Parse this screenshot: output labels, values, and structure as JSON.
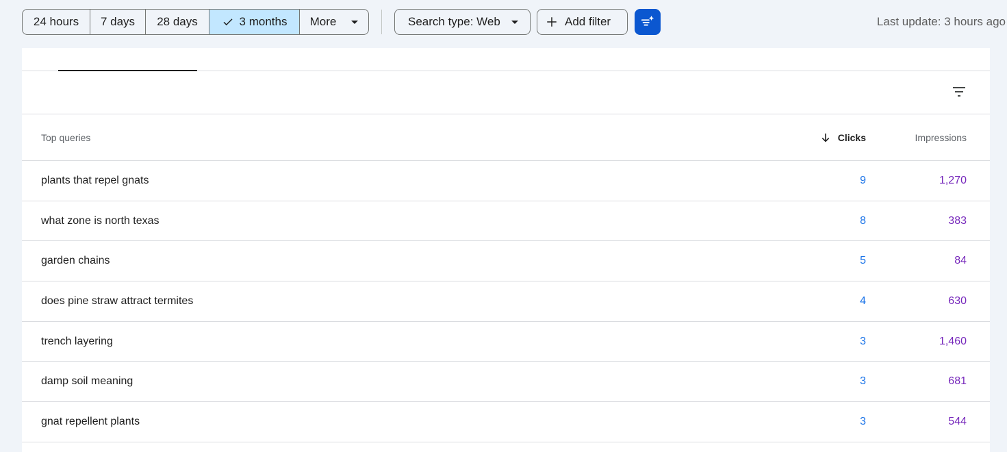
{
  "toolbar": {
    "date_ranges": [
      {
        "label": "24 hours",
        "active": false
      },
      {
        "label": "7 days",
        "active": false
      },
      {
        "label": "28 days",
        "active": false
      },
      {
        "label": "3 months",
        "active": true
      }
    ],
    "more_label": "More",
    "search_type_label": "Search type: Web",
    "add_filter_label": "Add filter",
    "last_update": "Last update: 3 hours ago"
  },
  "table": {
    "headers": {
      "query": "Top queries",
      "clicks": "Clicks",
      "impressions": "Impressions"
    },
    "rows": [
      {
        "query": "plants that repel gnats",
        "clicks": "9",
        "impressions": "1,270"
      },
      {
        "query": "what zone is north texas",
        "clicks": "8",
        "impressions": "383"
      },
      {
        "query": "garden chains",
        "clicks": "5",
        "impressions": "84"
      },
      {
        "query": "does pine straw attract termites",
        "clicks": "4",
        "impressions": "630"
      },
      {
        "query": "trench layering",
        "clicks": "3",
        "impressions": "1,460"
      },
      {
        "query": "damp soil meaning",
        "clicks": "3",
        "impressions": "681"
      },
      {
        "query": "gnat repellent plants",
        "clicks": "3",
        "impressions": "544"
      }
    ]
  },
  "colors": {
    "accent": "#0b57d0",
    "active_chip": "#c2e7ff",
    "clicks": "#1a73e8",
    "impressions": "#7627bb"
  },
  "icons": {
    "check": "check-icon",
    "dropdown": "chevron-down-icon",
    "add": "plus-icon",
    "ai_filter": "sparkle-filter-icon",
    "table_filter": "filter-icon",
    "sort": "arrow-down-icon"
  }
}
